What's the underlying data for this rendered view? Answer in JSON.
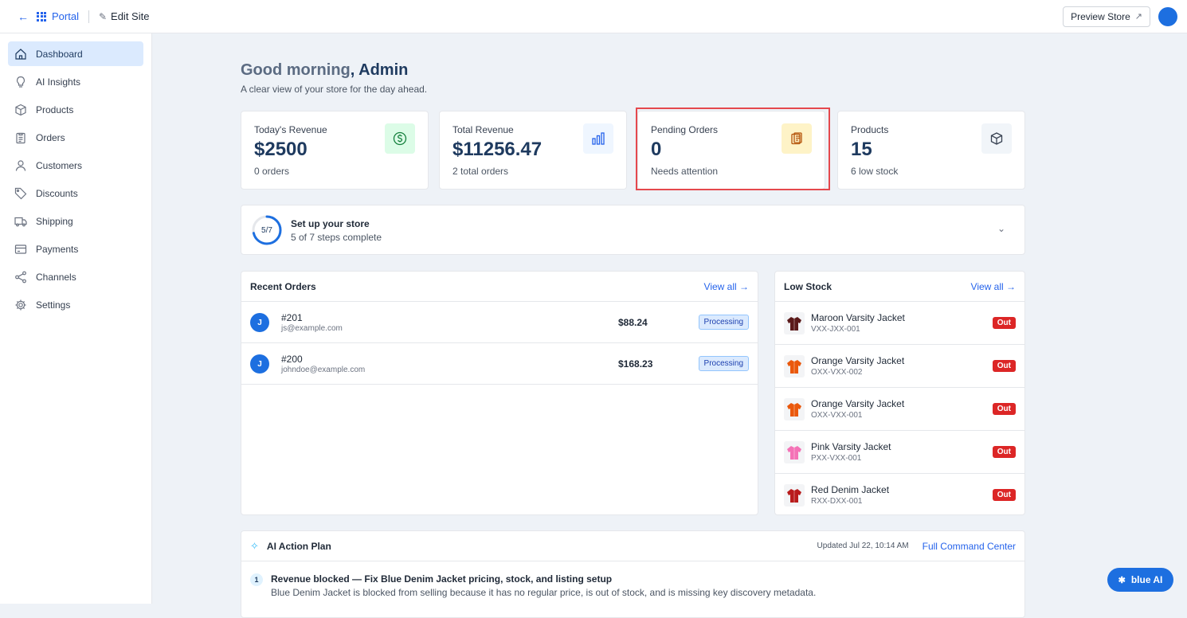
{
  "topbar": {
    "back_icon": "arrow-left-icon",
    "portal_label": "Portal",
    "edit_label": "Edit Site",
    "preview_label": "Preview Store"
  },
  "sidebar": {
    "items": [
      {
        "label": "Dashboard",
        "icon": "home-icon",
        "active": true
      },
      {
        "label": "AI Insights",
        "icon": "lightbulb-icon"
      },
      {
        "label": "Products",
        "icon": "box-icon"
      },
      {
        "label": "Orders",
        "icon": "clipboard-icon"
      },
      {
        "label": "Customers",
        "icon": "user-icon"
      },
      {
        "label": "Discounts",
        "icon": "tag-icon"
      },
      {
        "label": "Shipping",
        "icon": "truck-icon"
      },
      {
        "label": "Payments",
        "icon": "credit-card-icon"
      },
      {
        "label": "Channels",
        "icon": "share-icon"
      },
      {
        "label": "Settings",
        "icon": "gear-icon"
      }
    ]
  },
  "greeting": {
    "prefix": "Good morning",
    "name": ", Admin",
    "subtitle": "A clear view of your store for the day ahead."
  },
  "stats": [
    {
      "label": "Today's Revenue",
      "value": "$2500",
      "sub": "0 orders",
      "icon": "dollar-icon",
      "icon_bg": "#dcfce7",
      "icon_color": "#15803d"
    },
    {
      "label": "Total Revenue",
      "value": "$11256.47",
      "sub": "2 total orders",
      "icon": "bar-chart-icon",
      "icon_bg": "#eff6ff",
      "icon_color": "#2563eb"
    },
    {
      "label": "Pending Orders",
      "value": "0",
      "sub": "Needs attention",
      "icon": "clipboard-icon",
      "icon_bg": "#fef3c7",
      "icon_color": "#b45309"
    },
    {
      "label": "Products",
      "value": "15",
      "sub": "6 low stock",
      "icon": "box-icon",
      "icon_bg": "#f1f5f9",
      "icon_color": "#374151"
    }
  ],
  "setup": {
    "progress_text": "5/7",
    "progress": 0.714,
    "title": "Set up your store",
    "subtitle": "5 of 7 steps complete"
  },
  "recent_orders": {
    "title": "Recent Orders",
    "view_all": "View all →",
    "rows": [
      {
        "initial": "J",
        "id": "#201",
        "email": "js@example.com",
        "amount": "$88.24",
        "status": "Processing"
      },
      {
        "initial": "J",
        "id": "#200",
        "email": "johndoe@example.com",
        "amount": "$168.23",
        "status": "Processing"
      }
    ]
  },
  "low_stock": {
    "title": "Low Stock",
    "view_all": "View all →",
    "rows": [
      {
        "name": "Maroon Varsity Jacket",
        "sku": "VXX-JXX-001",
        "badge": "Out",
        "color": "#5b1a1a"
      },
      {
        "name": "Orange Varsity Jacket",
        "sku": "OXX-VXX-002",
        "badge": "Out",
        "color": "#ea580c"
      },
      {
        "name": "Orange Varsity Jacket",
        "sku": "OXX-VXX-001",
        "badge": "Out",
        "color": "#ea580c"
      },
      {
        "name": "Pink Varsity Jacket",
        "sku": "PXX-VXX-001",
        "badge": "Out",
        "color": "#f472b6"
      },
      {
        "name": "Red Denim Jacket",
        "sku": "RXX-DXX-001",
        "badge": "Out",
        "color": "#b91c1c"
      }
    ]
  },
  "ai_plan": {
    "title": "AI Action Plan",
    "updated": "Updated Jul 22, 10:14 AM",
    "link": "Full Command Center",
    "items": [
      {
        "num": "1",
        "title": "Revenue blocked — Fix Blue Denim Jacket pricing, stock, and listing setup",
        "desc": "Blue Denim Jacket is blocked from selling because it has no regular price, is out of stock, and is missing key discovery metadata."
      }
    ]
  },
  "assistant": {
    "label": "blue AI",
    "icon": "sparkle-icon"
  }
}
